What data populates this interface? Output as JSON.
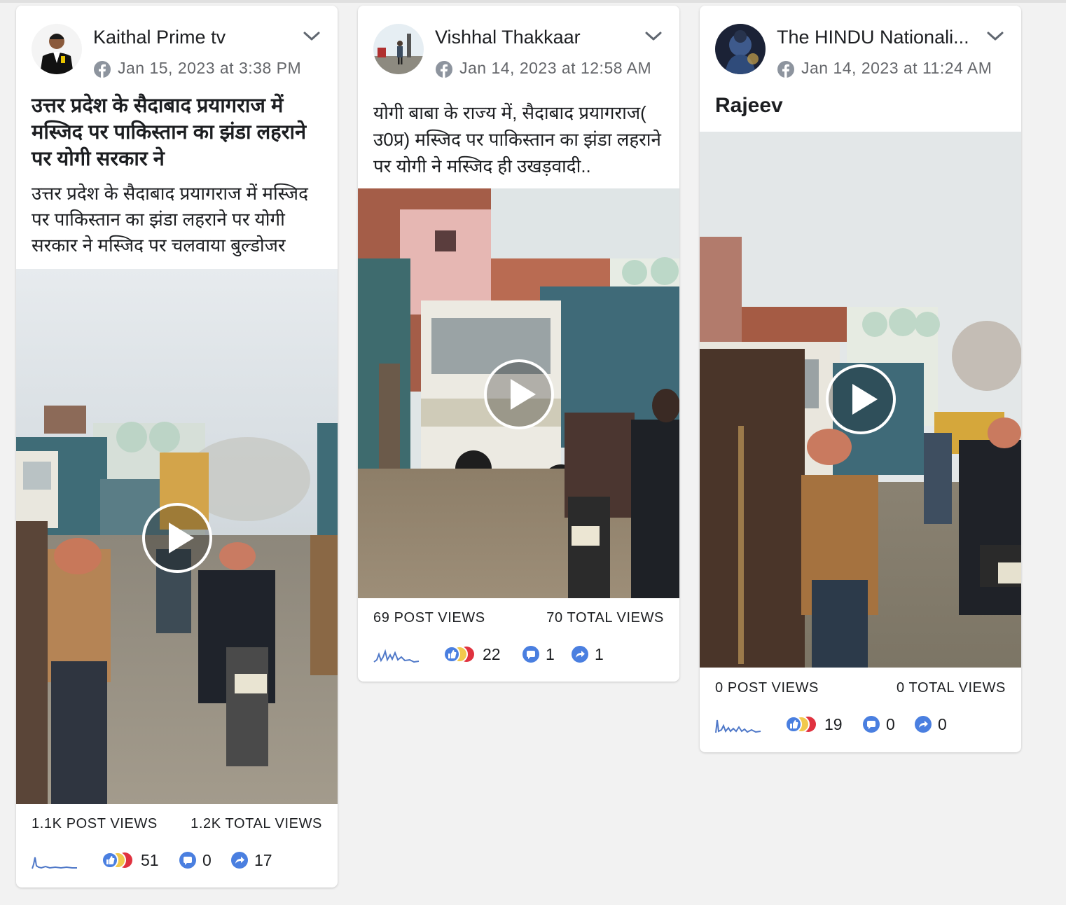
{
  "posts": [
    {
      "author": "Kaithal Prime tv",
      "date": "Jan 15, 2023 at 3:38 PM",
      "title": "उत्तर प्रदेश के सैदाबाद प्रयागराज में मस्जिद पर पाकिस्तान का झंडा लहराने पर योगी सरकार ने",
      "description": "उत्तर प्रदेश के सैदाबाद प्रयागराज में मस्जिद पर पाकिस्तान का झंडा लहराने पर योगी सरकार ने मस्जिद पर चलवाया बुल्डोजर",
      "post_views": "1.1K POST VIEWS",
      "total_views": "1.2K TOTAL VIEWS",
      "reactions": "51",
      "comments": "0",
      "shares": "17"
    },
    {
      "author": "Vishhal Thakkaar",
      "date": "Jan 14, 2023 at 12:58 AM",
      "title": "",
      "description": "योगी बाबा के राज्य में, सैदाबाद प्रयागराज( उ0प्र) मस्जिद पर पाकिस्तान का झंडा लहराने पर योगी ने मस्जिद ही उखड़वादी..",
      "post_views": "69 POST VIEWS",
      "total_views": "70 TOTAL VIEWS",
      "reactions": "22",
      "comments": "1",
      "shares": "1"
    },
    {
      "author": "The HINDU Nationali...",
      "date": "Jan 14, 2023 at 11:24 AM",
      "title": "Rajeev",
      "description": "",
      "post_views": "0 POST VIEWS",
      "total_views": "0 TOTAL VIEWS",
      "reactions": "19",
      "comments": "0",
      "shares": "0"
    }
  ],
  "icons": {
    "platform": "facebook-icon",
    "menu": "chevron-down-icon",
    "play": "play-icon",
    "reactions": "like-haha-reaction-icon",
    "comments": "comment-icon",
    "shares": "share-icon",
    "trend": "sparkline-icon"
  },
  "colors": {
    "background": "#f2f2f2",
    "card": "#ffffff",
    "meta_gray": "#65676b",
    "like_blue": "#4a7fe0",
    "haha_yellow": "#f2c94c",
    "love_red": "#e0323f",
    "spark_blue": "#4f78c8"
  }
}
